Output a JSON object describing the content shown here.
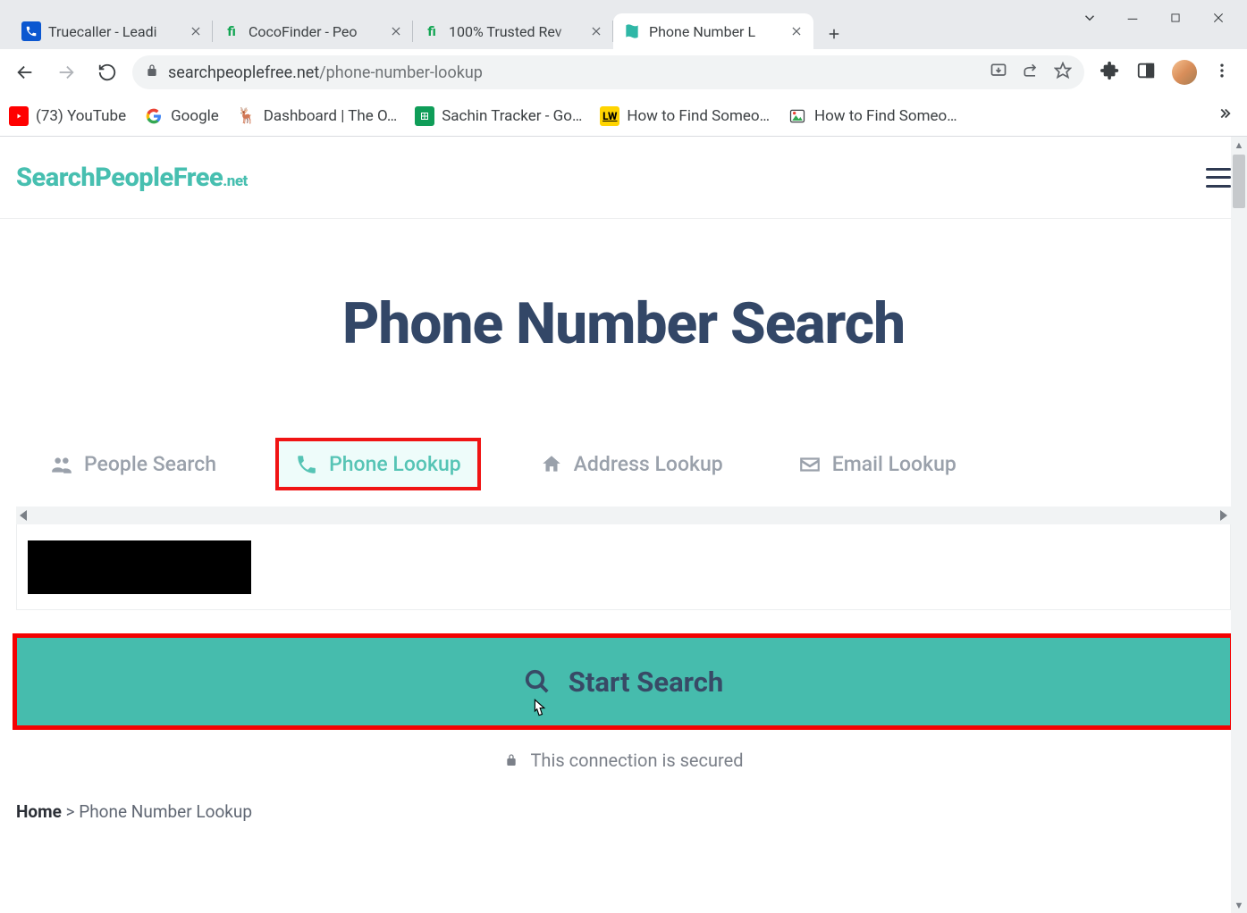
{
  "window": {
    "tabs": [
      {
        "title": "Truecaller - Leadi",
        "favicon": "phone-blue"
      },
      {
        "title": "CocoFinder - Peo",
        "favicon": "fi-green"
      },
      {
        "title": "100% Trusted Rev",
        "favicon": "fi-green"
      },
      {
        "title": "Phone Number L",
        "favicon": "spf-teal",
        "active": true
      }
    ]
  },
  "toolbar": {
    "url_host": "searchpeoplefree.net",
    "url_path": "/phone-number-lookup"
  },
  "bookmarks": [
    {
      "label": "(73) YouTube",
      "icon": "yt"
    },
    {
      "label": "Google",
      "icon": "google"
    },
    {
      "label": "Dashboard | The O…",
      "icon": "deer"
    },
    {
      "label": "Sachin Tracker - Go…",
      "icon": "sheets"
    },
    {
      "label": "How to Find Someo…",
      "icon": "lw"
    },
    {
      "label": "How to Find Someo…",
      "icon": "pic"
    }
  ],
  "site": {
    "brand_main": "SearchPeopleFree",
    "brand_sub": ".net",
    "hero_title": "Phone Number Search",
    "tabs": {
      "people": "People Search",
      "phone": "Phone Lookup",
      "address": "Address Lookup",
      "email": "Email Lookup"
    },
    "start_button": "Start Search",
    "secured_text": "This connection is secured",
    "breadcrumb_home": "Home",
    "breadcrumb_sep": ">",
    "breadcrumb_current": "Phone Number Lookup"
  }
}
